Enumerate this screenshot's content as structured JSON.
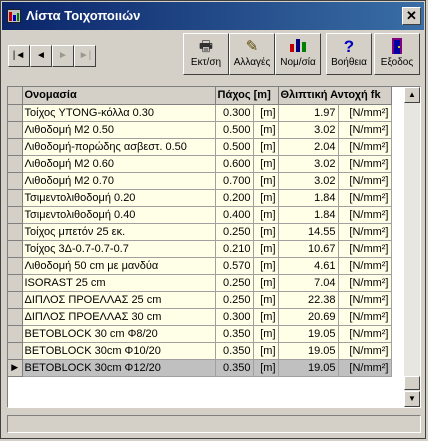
{
  "window": {
    "title": "Λίστα Τοιχοποιιών",
    "close_label": "✕"
  },
  "nav": {
    "first": "|◄",
    "prev": "◄",
    "next": "►",
    "last": "►|"
  },
  "toolbar": [
    {
      "label": "Εκτ/ση",
      "icon": "printer-icon",
      "glyph": "🖶"
    },
    {
      "label": "Αλλαγές",
      "icon": "edit-document-icon",
      "glyph": "✎"
    },
    {
      "label": "Νομ/σία",
      "icon": "bar-chart-icon",
      "glyph": "▐"
    },
    {
      "label": "Βοήθεια",
      "icon": "help-icon",
      "glyph": "?"
    },
    {
      "label": "Εξοδος",
      "icon": "exit-door-icon",
      "glyph": "▯"
    }
  ],
  "grid": {
    "headers": [
      "Ονομασία",
      "Πάχος [m]",
      "Θλιπτική Αντοχή fk"
    ],
    "rows": [
      {
        "name": "Τοίχος YTONG-κόλλα 0.30",
        "thickness": "0.300",
        "tunit": "[m]",
        "strength": "1.97",
        "sunit": "[N/mm²]"
      },
      {
        "name": "Λιθοδομή  Μ2 0.50",
        "thickness": "0.500",
        "tunit": "[m]",
        "strength": "3.02",
        "sunit": "[N/mm²]"
      },
      {
        "name": "Λιθοδομή-πορώδης ασβεστ. 0.50",
        "thickness": "0.500",
        "tunit": "[m]",
        "strength": "2.04",
        "sunit": "[N/mm²]"
      },
      {
        "name": "Λιθοδομή Μ2 0.60",
        "thickness": "0.600",
        "tunit": "[m]",
        "strength": "3.02",
        "sunit": "[N/mm²]"
      },
      {
        "name": "Λιθοδομή Μ2 0.70",
        "thickness": "0.700",
        "tunit": "[m]",
        "strength": "3.02",
        "sunit": "[N/mm²]"
      },
      {
        "name": "Τσιμεντολιθοδομή 0.20",
        "thickness": "0.200",
        "tunit": "[m]",
        "strength": "1.84",
        "sunit": "[N/mm²]"
      },
      {
        "name": "Τσιμεντολιθοδομή 0.40",
        "thickness": "0.400",
        "tunit": "[m]",
        "strength": "1.84",
        "sunit": "[N/mm²]"
      },
      {
        "name": "Τοίχος μπετόν 25 εκ.",
        "thickness": "0.250",
        "tunit": "[m]",
        "strength": "14.55",
        "sunit": "[N/mm²]"
      },
      {
        "name": "Τοίχος 3Δ-0.7-0.7-0.7",
        "thickness": "0.210",
        "tunit": "[m]",
        "strength": "10.67",
        "sunit": "[N/mm²]"
      },
      {
        "name": "Λιθοδομή 50 cm με μανδύα",
        "thickness": "0.570",
        "tunit": "[m]",
        "strength": "4.61",
        "sunit": "[N/mm²]"
      },
      {
        "name": "ISORAST 25 cm",
        "thickness": "0.250",
        "tunit": "[m]",
        "strength": "7.04",
        "sunit": "[N/mm²]"
      },
      {
        "name": "ΔΙΠΛΟΣ ΠΡΟΕΛΛΑΣ 25 cm",
        "thickness": "0.250",
        "tunit": "[m]",
        "strength": "22.38",
        "sunit": "[N/mm²]"
      },
      {
        "name": "ΔΙΠΛΟΣ ΠΡΟΕΛΛΑΣ 30 cm",
        "thickness": "0.300",
        "tunit": "[m]",
        "strength": "20.69",
        "sunit": "[N/mm²]"
      },
      {
        "name": "BETOBLOCK 30 cm Φ8/20",
        "thickness": "0.350",
        "tunit": "[m]",
        "strength": "19.05",
        "sunit": "[N/mm²]"
      },
      {
        "name": "BETOBLOCK 30cm Φ10/20",
        "thickness": "0.350",
        "tunit": "[m]",
        "strength": "19.05",
        "sunit": "[N/mm²]"
      },
      {
        "name": "BETOBLOCK 30cm Φ12/20",
        "thickness": "0.350",
        "tunit": "[m]",
        "strength": "19.05",
        "sunit": "[N/mm²]",
        "selected": true
      }
    ]
  }
}
